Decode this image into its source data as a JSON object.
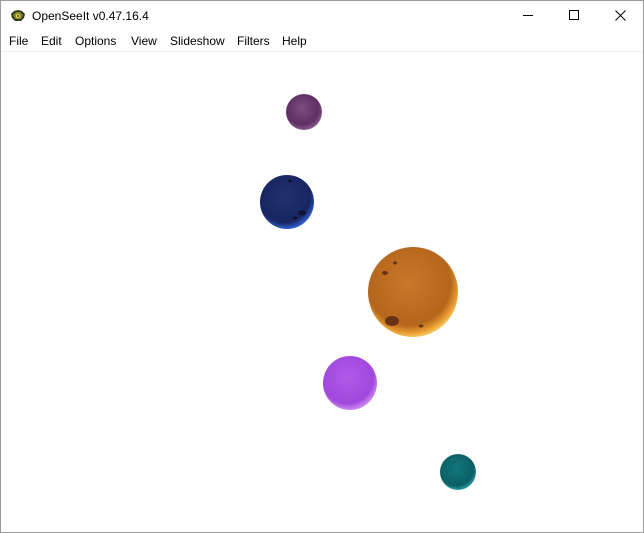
{
  "window": {
    "title": "OpenSeeIt v0.47.16.4",
    "app_icon": "openseeit-logo-icon",
    "controls": [
      "minimize-icon",
      "maximize-icon",
      "close-icon"
    ]
  },
  "menu": [
    {
      "label": "File"
    },
    {
      "label": "Edit"
    },
    {
      "label": "Options"
    },
    {
      "label": "View"
    },
    {
      "label": "Slideshow"
    },
    {
      "label": "Filters"
    },
    {
      "label": "Help"
    }
  ],
  "viewport": {
    "background": "#ffffff",
    "content": "image-canvas",
    "spheres": [
      {
        "name": "purple-small-sphere",
        "color": "#6b3b6e"
      },
      {
        "name": "blue-sphere",
        "color": "#1e3a8a"
      },
      {
        "name": "orange-sphere",
        "color": "#c8731e"
      },
      {
        "name": "violet-sphere",
        "color": "#a64ee0"
      },
      {
        "name": "teal-sphere",
        "color": "#0f6f74"
      }
    ]
  }
}
